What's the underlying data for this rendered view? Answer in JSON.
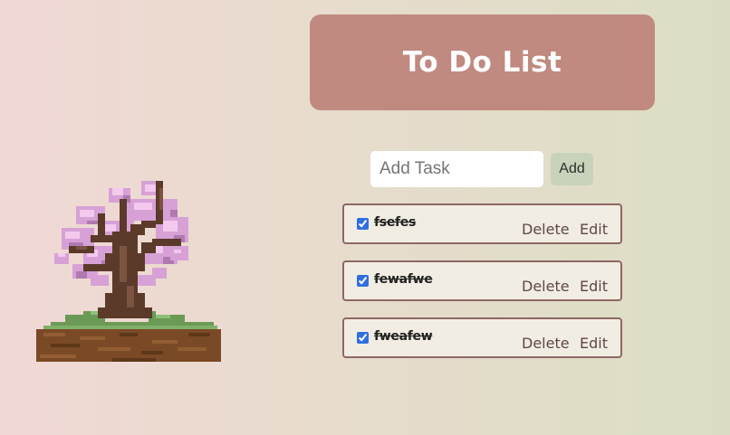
{
  "header": {
    "title": "To Do List"
  },
  "add_task": {
    "placeholder": "Add Task",
    "value": "",
    "button_label": "Add"
  },
  "tasks": [
    {
      "text": "fsefes",
      "completed": true,
      "delete_label": "Delete",
      "edit_label": "Edit"
    },
    {
      "text": "fewafwe",
      "completed": true,
      "delete_label": "Delete",
      "edit_label": "Edit"
    },
    {
      "text": "fweafew",
      "completed": true,
      "delete_label": "Delete",
      "edit_label": "Edit"
    }
  ],
  "colors": {
    "header_bg": "#c08a80",
    "header_text": "#ffffff",
    "add_button_bg": "#c9d3bb",
    "task_border": "#8f6666",
    "task_bg": "#f2ede2",
    "action_text": "#5e4848",
    "bg_left": "#f1d8d5",
    "bg_right": "#dcdec3"
  },
  "icons": {
    "illustration": "pixel-cherry-blossom-tree"
  }
}
